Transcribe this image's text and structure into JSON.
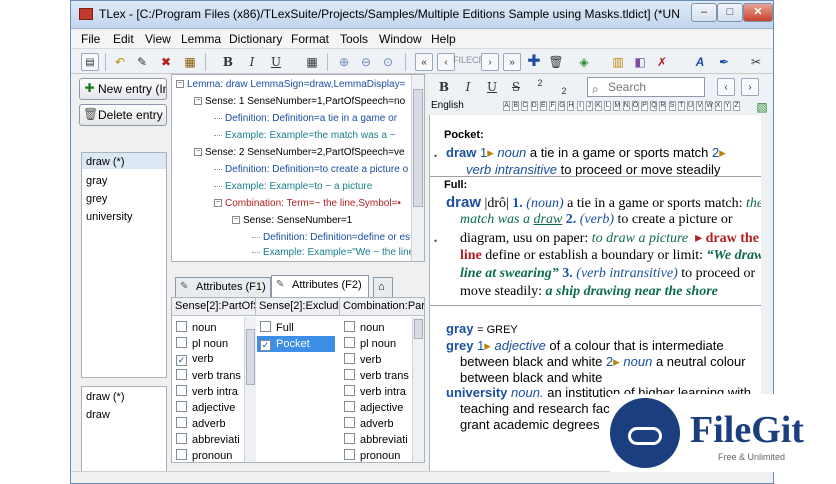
{
  "window": {
    "title": "TLex - [C:/Program Files (x86)/TLexSuite/Projects/Samples/Multiple Editions Sample using Masks.tldict] (*UNSAV...",
    "min": "–",
    "max": "□",
    "close": "✕"
  },
  "menu": [
    "File",
    "Edit",
    "View",
    "Lemma",
    "Dictionary",
    "Format",
    "Tools",
    "Window",
    "Help"
  ],
  "toolbar": {
    "bold": "B",
    "italic": "I",
    "underline": "U",
    "strike": "S",
    "faint_overlay": "FILECR"
  },
  "left": {
    "new_entry": "New entry (Ins)",
    "delete_entry": "Delete entry",
    "entries": [
      "draw (*)",
      "gray",
      "grey",
      "university"
    ],
    "related": [
      "draw (*)",
      "draw"
    ]
  },
  "tree": [
    {
      "kind": "lemma",
      "text": "Lemma: draw  LemmaSign=draw,LemmaDisplay="
    },
    {
      "kind": "sense",
      "text": "Sense: 1  SenseNumber=1,PartOfSpeech=no"
    },
    {
      "kind": "def",
      "text": "Definition:  Definition=a tie in a game or"
    },
    {
      "kind": "ex",
      "text": "Example:  Example=the match was a ~"
    },
    {
      "kind": "sense",
      "text": "Sense: 2  SenseNumber=2,PartOfSpeech=ve"
    },
    {
      "kind": "def",
      "text": "Definition:  Definition=to create a picture o"
    },
    {
      "kind": "ex",
      "text": "Example:  Example=to ~ a picture"
    },
    {
      "kind": "comb",
      "text": "Combination:  Term=~ the line,Symbol=•"
    },
    {
      "kind": "sense",
      "text": "Sense:  SenseNumber=1"
    },
    {
      "kind": "def",
      "text": "Definition:  Definition=define or es"
    },
    {
      "kind": "ex",
      "text": "Example:  Example=\"We ~ the line"
    }
  ],
  "tabs": [
    "Attributes (F1)",
    "Attributes (F2)"
  ],
  "attributes": {
    "headers": [
      "Sense[2]:PartOfS",
      "Sense[2]:Exclude",
      "Combination:Par"
    ],
    "col1": [
      {
        "label": "noun",
        "checked": false
      },
      {
        "label": "pl noun",
        "checked": false
      },
      {
        "label": "verb",
        "checked": true
      },
      {
        "label": "verb trans",
        "checked": false
      },
      {
        "label": "verb intra",
        "checked": false
      },
      {
        "label": "adjective",
        "checked": false
      },
      {
        "label": "adverb",
        "checked": false
      },
      {
        "label": "abbreviati",
        "checked": false
      },
      {
        "label": "pronoun",
        "checked": false
      }
    ],
    "col2": [
      {
        "label": "Full",
        "checked": false
      },
      {
        "label": "Pocket",
        "checked": true
      }
    ],
    "col3": [
      {
        "label": "noun",
        "checked": false
      },
      {
        "label": "pl noun",
        "checked": false
      },
      {
        "label": "verb",
        "checked": false
      },
      {
        "label": "verb trans",
        "checked": false
      },
      {
        "label": "verb intra",
        "checked": false
      },
      {
        "label": "adjective",
        "checked": false
      },
      {
        "label": "adverb",
        "checked": false
      },
      {
        "label": "abbreviati",
        "checked": false
      },
      {
        "label": "pronoun",
        "checked": false
      }
    ]
  },
  "preview_toolbar": {
    "bold": "B",
    "italic": "I",
    "underline": "U",
    "strike": "S",
    "sup": "2",
    "sub": "2",
    "search_placeholder": "Search"
  },
  "language": "English",
  "letters": [
    "A",
    "B",
    "C",
    "D",
    "E",
    "F",
    "G",
    "H",
    "I",
    "J",
    "K",
    "L",
    "M",
    "N",
    "O",
    "P",
    "Q",
    "R",
    "S",
    "T",
    "U",
    "V",
    "W",
    "X",
    "Y",
    "Z"
  ],
  "preview": {
    "pocket_label": "Pocket:",
    "pocket_hw": "draw",
    "pocket_n1": "1",
    "pocket_pos1": "noun",
    "pocket_def1": "a tie in a game or sports match",
    "pocket_n2": "2",
    "pocket_pos2": "verb intransitive",
    "pocket_def2": "to proceed or move steadily",
    "full_label": "Full:",
    "full_hw": "draw",
    "full_pron": "|drô|",
    "full_n1": "1.",
    "full_pos1": "(noun)",
    "full_def1": "a tie in a game or sports match:",
    "full_ex1a": "the",
    "full_ex1b": "match was a",
    "full_ex1c": "draw",
    "full_n2": "2.",
    "full_pos2": "(verb)",
    "full_def2a": "to create a picture or",
    "full_def2b": "diagram, usu on paper:",
    "full_ex2": "to draw a picture",
    "full_comb1": "draw the",
    "full_comb2": "line",
    "full_def3": "define or establish a boundary or limit:",
    "full_ex3a": "“We draw the",
    "full_ex3b": "line at swearing”",
    "full_n3": "3.",
    "full_pos3": "(verb intransitive)",
    "full_def4": "to proceed or",
    "full_def5": "move steadily:",
    "full_ex4": "a ship drawing near the shore",
    "gray_hw": "gray",
    "gray_xref": "= GREY",
    "grey_hw": "grey",
    "grey_n1": "1",
    "grey_pos1": "adjective",
    "grey_def1a": "of a colour that is intermediate",
    "grey_def1b": "between black and white",
    "grey_n2": "2",
    "grey_pos2": "noun",
    "grey_def2a": "a neutral colour",
    "grey_def2b": "between black and white",
    "univ_hw": "university",
    "univ_pos": "noun.",
    "univ_def1": "an institution of higher learning with",
    "univ_def2": "teaching and research fac",
    "univ_def3": "grant academic degrees"
  },
  "watermark": {
    "name": "FileGit",
    "tagline": "Free & Unlimited"
  }
}
